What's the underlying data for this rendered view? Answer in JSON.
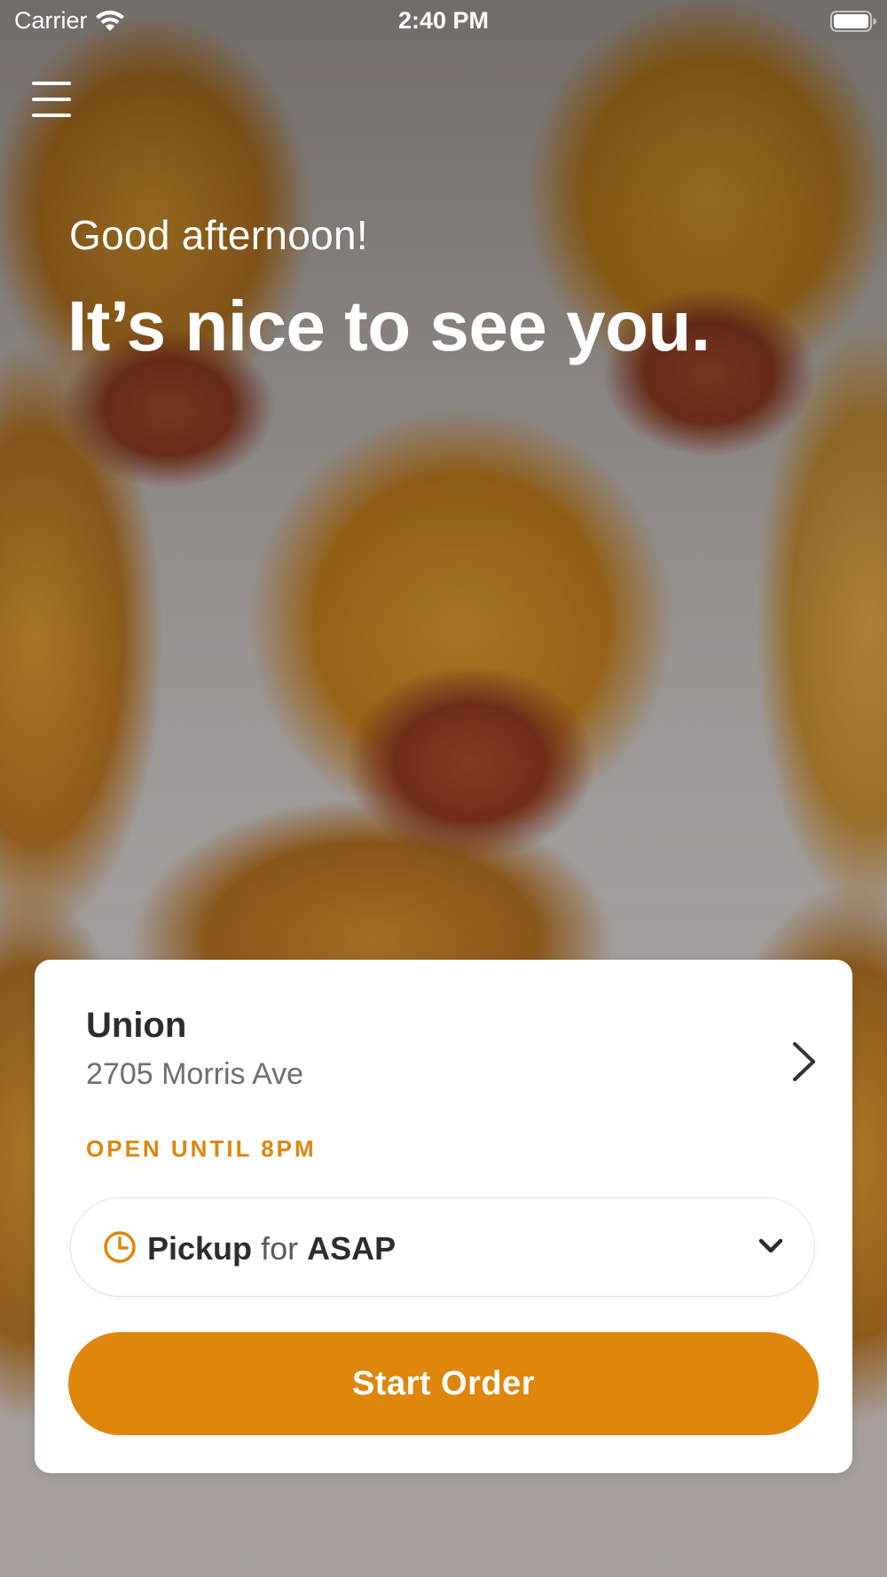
{
  "status_bar": {
    "carrier": "Carrier",
    "time": "2:40 PM",
    "wifi_icon": "wifi-icon",
    "battery_icon": "battery-icon"
  },
  "header": {
    "menu_icon": "hamburger-menu-icon"
  },
  "hero": {
    "greeting": "Good afternoon!",
    "headline": "It’s nice to see you."
  },
  "location_card": {
    "name": "Union",
    "address": "2705 Morris Ave",
    "hours": "OPEN UNTIL 8PM",
    "chevron_icon": "chevron-right-icon",
    "pickup": {
      "mode": "Pickup",
      "connector": "for",
      "time": "ASAP",
      "clock_icon": "clock-icon",
      "dropdown_icon": "chevron-down-icon"
    },
    "start_order_label": "Start Order"
  },
  "colors": {
    "accent": "#df860c",
    "card_background": "#ffffff",
    "primary_text": "#2c2c2c",
    "secondary_text": "#6e6e6e"
  }
}
